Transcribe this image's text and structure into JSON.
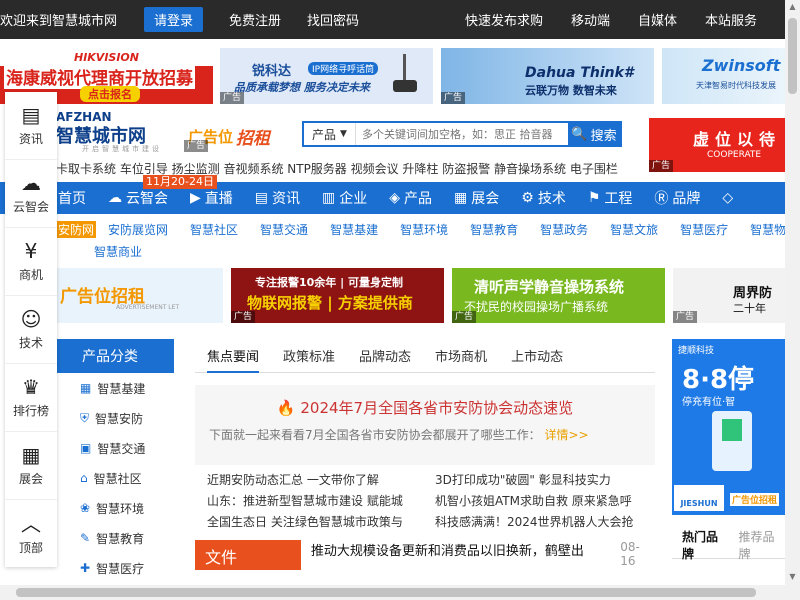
{
  "topbar": {
    "welcome": "欢迎来到智慧城市网",
    "login": "请登录",
    "register": "免费注册",
    "recover": "找回密码",
    "right": [
      "快速发布求购",
      "移动端",
      "自媒体",
      "本站服务"
    ]
  },
  "banners": {
    "hikvision_brand": "HIKVISION",
    "hikvision_sub": "海康威视代理商开放招募",
    "hikvision_cta": "点击报名",
    "ruikeda_name": "锐科达",
    "ruikeda_tag": "IP网络寻呼话筒",
    "ruikeda_slogan": "品质承载梦想  服务决定未来",
    "dahua_name": "Dahua Think#",
    "dahua_slogan": "云联万物  数智未来",
    "zwinsoft_name": "Zwinsoft",
    "zwinsoft_sub": "天津智易时代科技发展",
    "ad_tag": "广告"
  },
  "sidebar": {
    "items": [
      {
        "label": "资讯",
        "icon": "document-icon"
      },
      {
        "label": "云智会",
        "icon": "cloud-person-icon"
      },
      {
        "label": "商机",
        "icon": "moneybag-icon"
      },
      {
        "label": "技术",
        "icon": "tech-person-icon"
      },
      {
        "label": "排行榜",
        "icon": "trophy-icon"
      },
      {
        "label": "展会",
        "icon": "exhibition-icon"
      },
      {
        "label": "顶部",
        "icon": "chevron-up-icon"
      }
    ]
  },
  "logo": {
    "en": "AFZHAN",
    "cn": "智慧城市网",
    "tagline": "开启智慧城市建设"
  },
  "rental_ad": {
    "text1": "广告位",
    "text2": "招租"
  },
  "search": {
    "category": "产品",
    "placeholder": "多个关键词间加空格，如：思正 拾音器",
    "button": "搜索"
  },
  "right_promo": {
    "text": "虚位以待",
    "sub": "COOPERATE"
  },
  "hotwords": "卡取卡系统 车位引导 扬尘监测 音视频系统 NTP服务器 视频会议 升降柱 防盗报警 静音操场系统 电子围栏",
  "date_badge": "11月20-24日",
  "mainnav": [
    {
      "label": "首页",
      "icon": ""
    },
    {
      "label": "云智会",
      "icon": "cloud-icon"
    },
    {
      "label": "直播",
      "icon": "play-icon"
    },
    {
      "label": "资讯",
      "icon": "news-icon"
    },
    {
      "label": "企业",
      "icon": "building-icon"
    },
    {
      "label": "产品",
      "icon": "box-icon"
    },
    {
      "label": "展会",
      "icon": "exhibition-icon"
    },
    {
      "label": "技术",
      "icon": "gear-icon"
    },
    {
      "label": "工程",
      "icon": "flag-icon"
    },
    {
      "label": "品牌",
      "icon": "brand-icon"
    }
  ],
  "subnav": [
    [
      "安防网",
      "安防展览网",
      "智慧社区",
      "智慧交通",
      "智慧基建",
      "智慧环境",
      "智慧教育",
      "智慧政务",
      "智慧文旅",
      "智慧医疗",
      "智慧物流"
    ],
    [
      "智慧商业"
    ]
  ],
  "middle_ads": {
    "ad1_main": "广告位招租",
    "ad1_sub": "ADVERTISEMENT LET",
    "ad2_main": "专注报警10余年 | 可量身定制",
    "ad2_sub": "物联网报警 | 方案提供商",
    "ad3_main": "清听声学静音操场系统",
    "ad3_sub": "不扰民的校园操场广播系统",
    "ad4_main": "周界防",
    "ad4_sub": "二十年"
  },
  "product_category": {
    "title": "产品分类",
    "items": [
      "智慧基建",
      "智慧安防",
      "智慧交通",
      "智慧社区",
      "智慧环境",
      "智慧教育",
      "智慧医疗"
    ]
  },
  "news": {
    "tabs": [
      "焦点要闻",
      "政策标准",
      "品牌动态",
      "市场商机",
      "上市动态"
    ],
    "featured_title": "2024年7月全国各省市安防协会动态速览",
    "featured_desc": "下面就一起来看看7月全国各省市安防协会都展开了哪些工作：",
    "featured_more": "详情>>",
    "list": [
      "近期安防动态汇总 一文带你了解",
      "3D打印成功\"破圆\" 彰显科技实力",
      "山东：推进新型智慧城市建设 赋能城",
      "机智小孩姐ATM求助自救 原来紧急呼",
      "全国生态日 关注绿色智慧城市政策与",
      "科技感满满！2024世界机器人大会抢"
    ],
    "big_thumb": "文件",
    "big_title": "推动大规模设备更新和消费品以旧换新，鹤壁出",
    "big_date": "08-16"
  },
  "right_column": {
    "brand": "捷顺科技",
    "big": "8·8停",
    "sub": "停充有位·智",
    "bottom_brand": "JIESHUN",
    "bottom_ad": "广告位招租"
  },
  "hot_tabs": [
    "热门品牌",
    "推荐品牌"
  ],
  "colors": {
    "accent": "#1b6fd0",
    "topbar": "#2a2a2a",
    "orange": "#e8501e",
    "red": "#d9241c"
  }
}
